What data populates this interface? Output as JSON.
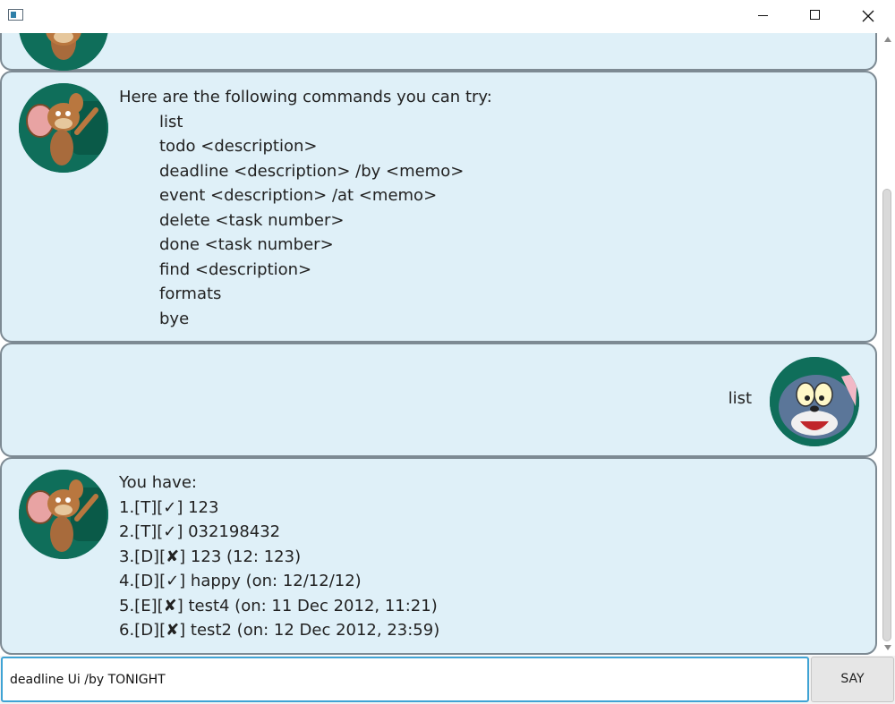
{
  "window": {
    "title": "",
    "controls": [
      "minimize-icon",
      "maximize-icon",
      "close-icon"
    ]
  },
  "conversation": {
    "help": {
      "intro": "Here are the following commands you can try:",
      "commands": [
        "list",
        "todo <description>",
        "deadline <description> /by <memo>",
        "event <description> /at <memo>",
        "delete <task number>",
        "done <task number>",
        "find <description>",
        "formats",
        "bye"
      ]
    },
    "user_message": "list",
    "task_list": {
      "intro": "You have:",
      "tasks": [
        "1.[T][✓] 123",
        "2.[T][✓] 032198432",
        "3.[D][✘] 123 (12: 123)",
        "4.[D][✓] happy (on: 12/12/12)",
        "5.[E][✘] test4 (on: 11 Dec 2012, 11:21)",
        "6.[D][✘] test2 (on: 12 Dec 2012, 23:59)"
      ]
    }
  },
  "input": {
    "value": "deadline Ui /by TONIGHT",
    "send_label": "SAY"
  },
  "colors": {
    "bubble_background": "#dff0f8",
    "bubble_border": "#7d8a93",
    "input_focus_border": "#3fa3d4",
    "avatar_background": "#0f6e5a"
  }
}
